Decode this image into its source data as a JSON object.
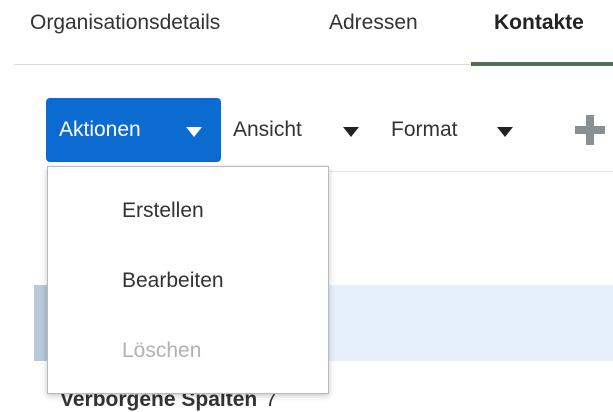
{
  "tabs": [
    {
      "label": "Organisationsdetails"
    },
    {
      "label": "Adressen"
    },
    {
      "label": "Kontakte",
      "active": true
    }
  ],
  "toolbar": {
    "actions_label": "Aktionen",
    "view_label": "Ansicht",
    "format_label": "Format",
    "add_icon": "plus-icon"
  },
  "actions_menu": {
    "items": [
      {
        "label": "Erstellen",
        "enabled": true
      },
      {
        "label": "Bearbeiten",
        "enabled": true
      },
      {
        "label": "Löschen",
        "enabled": false
      }
    ]
  },
  "table": {
    "hidden_columns_label": "Verborgene Spalten",
    "hidden_columns_count": "7"
  },
  "colors": {
    "accent": "#0b6bd1",
    "active_tab_bar": "#4f6f52",
    "selected_row": "#e5f0fb",
    "disabled_text": "#b0b3b6"
  }
}
